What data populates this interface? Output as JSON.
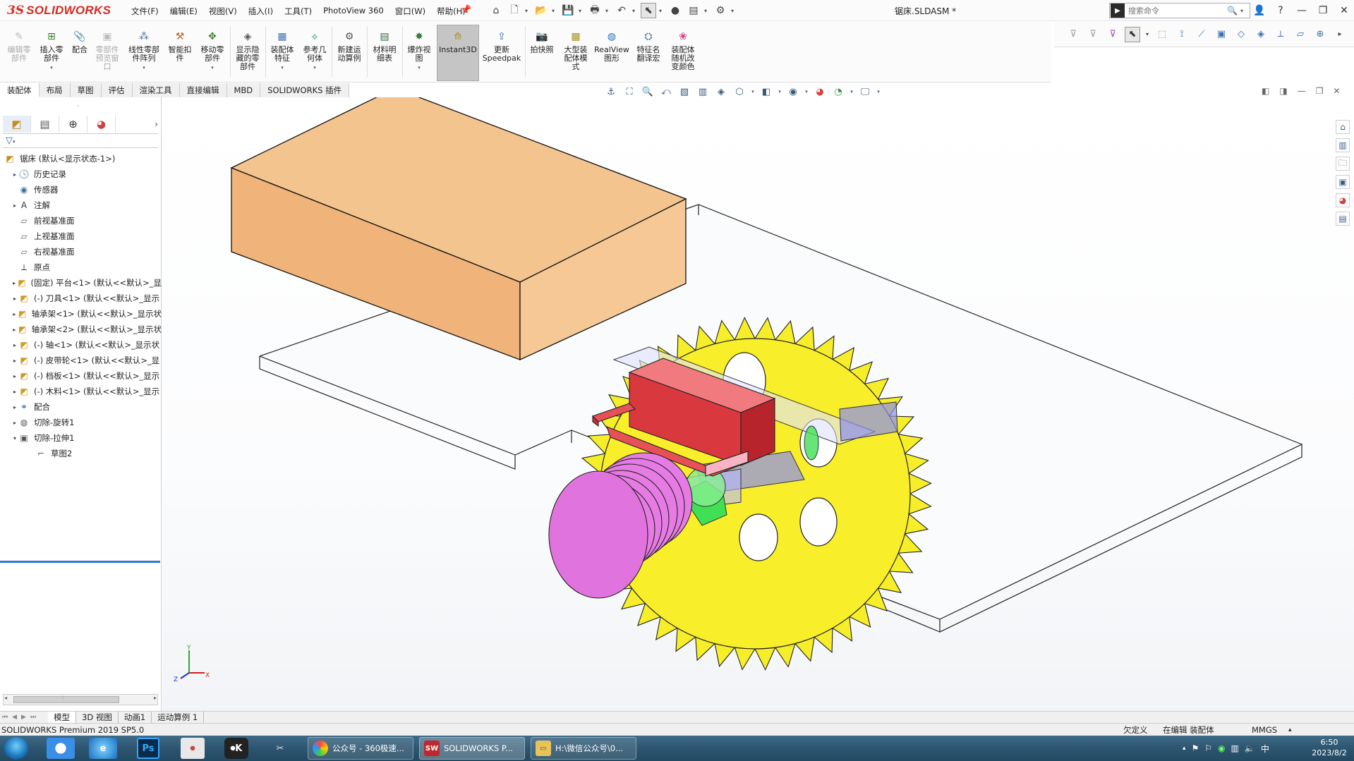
{
  "app": {
    "logo_ds": "3S",
    "logo_text": "SOLIDWORKS",
    "document_title": "锯床.SLDASM *",
    "search_placeholder": "搜索命令",
    "menus": [
      "文件(F)",
      "编辑(E)",
      "视图(V)",
      "插入(I)",
      "工具(T)",
      "PhotoView 360",
      "窗口(W)",
      "帮助(H)"
    ]
  },
  "commands": [
    {
      "label": "编辑零\n部件",
      "icon": "edit-component-icon",
      "disabled": true
    },
    {
      "label": "插入零\n部件",
      "icon": "insert-component-icon",
      "disabled": false
    },
    {
      "label": "配合",
      "icon": "mate-icon",
      "disabled": false
    },
    {
      "label": "零部件\n预览窗\n口",
      "icon": "component-preview-icon",
      "disabled": true
    },
    {
      "label": "线性零部\n件阵列",
      "icon": "linear-pattern-icon",
      "disabled": false
    },
    {
      "label": "智能扣\n件",
      "icon": "smart-fastener-icon",
      "disabled": false
    },
    {
      "label": "移动零\n部件",
      "icon": "move-component-icon",
      "disabled": false
    },
    {
      "label": "显示隐\n藏的零\n部件",
      "icon": "show-hidden-icon",
      "disabled": false
    },
    {
      "label": "装配体\n特征",
      "icon": "assembly-feature-icon",
      "disabled": false
    },
    {
      "label": "参考几\n何体",
      "icon": "reference-geometry-icon",
      "disabled": false
    },
    {
      "label": "新建运\n动算例",
      "icon": "motion-study-icon",
      "disabled": false
    },
    {
      "label": "材料明\n细表",
      "icon": "bom-icon",
      "disabled": false
    },
    {
      "label": "爆炸视\n图",
      "icon": "exploded-view-icon",
      "disabled": false
    },
    {
      "label": "Instant3D",
      "icon": "instant3d-icon",
      "disabled": false
    },
    {
      "label": "更新\nSpeedpak",
      "icon": "speedpak-icon",
      "disabled": false
    },
    {
      "label": "拍快照",
      "icon": "snapshot-icon",
      "disabled": false
    },
    {
      "label": "大型装\n配体模\n式",
      "icon": "large-assembly-icon",
      "disabled": false
    },
    {
      "label": "RealView\n图形",
      "icon": "realview-icon",
      "disabled": false
    },
    {
      "label": "特征名\n翻译宏",
      "icon": "translate-macro-icon",
      "disabled": false
    },
    {
      "label": "装配体\n随机改\n变颜色",
      "icon": "random-color-icon",
      "disabled": false
    }
  ],
  "cmd_tabs": [
    "装配体",
    "布局",
    "草图",
    "评估",
    "渲染工具",
    "直接编辑",
    "MBD",
    "SOLIDWORKS 插件"
  ],
  "tree": [
    {
      "label": "锯床 (默认<显示状态-1>)",
      "icon": "assembly-icon",
      "expand": "",
      "indent": 0
    },
    {
      "label": "历史记录",
      "icon": "history-icon",
      "expand": "▸",
      "indent": 1
    },
    {
      "label": "传感器",
      "icon": "sensor-icon",
      "expand": "",
      "indent": 1
    },
    {
      "label": "注解",
      "icon": "annotation-icon",
      "expand": "▸",
      "indent": 1
    },
    {
      "label": "前视基准面",
      "icon": "plane-icon",
      "expand": "",
      "indent": 1
    },
    {
      "label": "上视基准面",
      "icon": "plane-icon",
      "expand": "",
      "indent": 1
    },
    {
      "label": "右视基准面",
      "icon": "plane-icon",
      "expand": "",
      "indent": 1
    },
    {
      "label": "原点",
      "icon": "origin-icon",
      "expand": "",
      "indent": 1
    },
    {
      "label": "(固定) 平台<1> (默认<<默认>_显",
      "icon": "part-icon",
      "expand": "▸",
      "indent": 1
    },
    {
      "label": "(-) 刀具<1> (默认<<默认>_显示",
      "icon": "part-icon",
      "expand": "▸",
      "indent": 1
    },
    {
      "label": "轴承架<1> (默认<<默认>_显示状",
      "icon": "part-icon",
      "expand": "▸",
      "indent": 1
    },
    {
      "label": "轴承架<2> (默认<<默认>_显示状",
      "icon": "part-icon",
      "expand": "▸",
      "indent": 1
    },
    {
      "label": "(-) 轴<1> (默认<<默认>_显示状",
      "icon": "part-icon",
      "expand": "▸",
      "indent": 1
    },
    {
      "label": "(-) 皮带轮<1> (默认<<默认>_显",
      "icon": "part-icon",
      "expand": "▸",
      "indent": 1
    },
    {
      "label": "(-) 档板<1> (默认<<默认>_显示",
      "icon": "part-icon",
      "expand": "▸",
      "indent": 1
    },
    {
      "label": "(-) 木料<1> (默认<<默认>_显示",
      "icon": "part-icon",
      "expand": "▸",
      "indent": 1
    },
    {
      "label": "配合",
      "icon": "mates-icon",
      "expand": "▸",
      "indent": 1
    },
    {
      "label": "切除-旋转1",
      "icon": "cut-revolve-icon",
      "expand": "▸",
      "indent": 1
    },
    {
      "label": "切除-拉伸1",
      "icon": "cut-extrude-icon",
      "expand": "▾",
      "indent": 1
    },
    {
      "label": "草图2",
      "icon": "sketch-icon",
      "expand": "",
      "indent": 2
    }
  ],
  "bottom_tabs": [
    "模型",
    "3D 视图",
    "动画1",
    "运动算例 1"
  ],
  "status": {
    "version": "SOLIDWORKS Premium 2019 SP5.0",
    "state": "欠定义",
    "editing": "在编辑 装配体",
    "units": "MMGS"
  },
  "triad": {
    "x": "X",
    "y": "Y",
    "z": "Z"
  },
  "taskbar": {
    "tasks": [
      {
        "label": "公众号 - 360极速...",
        "icon": "360-browser-icon"
      },
      {
        "label": "SOLIDWORKS P...",
        "icon": "solidworks-task-icon"
      },
      {
        "label": "H:\\微信公众号\\0...",
        "icon": "folder-icon"
      }
    ],
    "time": "6:50",
    "date": "2023/8/2"
  },
  "colors": {
    "wood": "#f0b47a",
    "blade": "#f7ee2a",
    "pulley": "#e77be4",
    "bracket": "#d9383f",
    "accent": "#2a7bd6"
  }
}
